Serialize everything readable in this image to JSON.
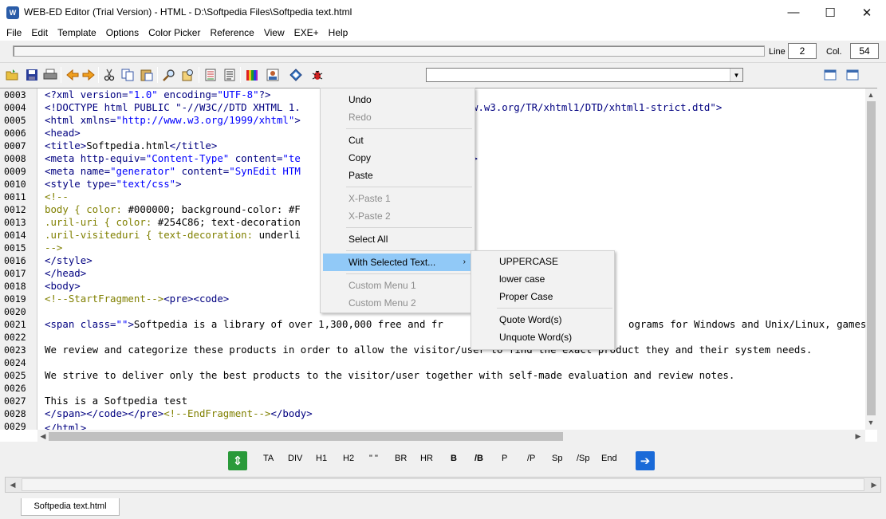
{
  "window": {
    "title": "WEB-ED Editor (Trial Version) - HTML - D:\\Softpedia Files\\Softpedia text.html",
    "minimize": "—",
    "maximize": "☐",
    "close": "✕"
  },
  "menubar": [
    "File",
    "Edit",
    "Template",
    "Options",
    "Color Picker",
    "Reference",
    "View",
    "EXE+",
    "Help"
  ],
  "position": {
    "line_label": "Line",
    "line_value": "2",
    "col_label": "Col.",
    "col_value": "54"
  },
  "line_numbers": [
    "0003",
    "0004",
    "0005",
    "0006",
    "0007",
    "0008",
    "0009",
    "0010",
    "0011",
    "0012",
    "0013",
    "0014",
    "0015",
    "0016",
    "0017",
    "0018",
    "0019",
    "0020",
    "0021",
    "0022",
    "0023",
    "0024",
    "0025",
    "0026",
    "0027",
    "0028",
    "0029"
  ],
  "code": {
    "l0003a": "<?xml version=",
    "l0003b": "\"1.0\"",
    "l0003c": " encoding=",
    "l0003d": "\"UTF-8\"",
    "l0003e": "?>",
    "l0004a": "<!DOCTYPE html PUBLIC \"-//W3C//DTD XHTML 1.",
    "l0004b": "w.w3.org/TR/xhtml1/DTD/xhtml1-strict.dtd\">",
    "l0005a": "<html xmlns=",
    "l0005b": "\"http://www.w3.org/1999/xhtml\"",
    "l0005c": ">",
    "l0006": "<head>",
    "l0007a": "<title>",
    "l0007b": "Softpedia.html",
    "l0007c": "</title>",
    "l0008a": "<meta http-equiv=",
    "l0008b": "\"Content-Type\"",
    "l0008c": " content=",
    "l0008d": "\"te",
    "l0008e": "/>",
    "l0009a": "<meta name=",
    "l0009b": "\"generator\"",
    "l0009c": " content=",
    "l0009d": "\"SynEdit HTM",
    "l0010a": "<style type=",
    "l0010b": "\"text/css\"",
    "l0010c": ">",
    "l0011": "<!--",
    "l0012a": "body { color: ",
    "l0012b": "#000000; background-color: #F",
    "l0013a": ".uril-uri { color: ",
    "l0013b": "#254C86; text-decoration",
    "l0014a": ".uril-visiteduri { text-decoration: ",
    "l0014b": "underli",
    "l0015": "-->",
    "l0016": "</style>",
    "l0017": "</head>",
    "l0018": "<body>",
    "l0019a": "<!--StartFragment-->",
    "l0019b": "<pre><code>",
    "l0021a": "<span class=",
    "l0021b": "\"\"",
    "l0021c": ">",
    "l0021d": "Softpedia is a library of over 1,300,000 free and fr",
    "l0021e": "ograms for Windows and Unix/Linux, games,",
    "l0023": "We review and categorize these products in order to allow the visitor/user to find the exact product they and their system needs.",
    "l0025": "We strive to deliver only the best products to the visitor/user together with self-made evaluation and review notes.",
    "l0027": "This is a Softpedia test",
    "l0028a": "</span></code></pre>",
    "l0028b": "<!--EndFragment-->",
    "l0028c": "</body>",
    "l0029": "</html>"
  },
  "context_menu": {
    "undo": "Undo",
    "redo": "Redo",
    "cut": "Cut",
    "copy": "Copy",
    "paste": "Paste",
    "xpaste1": "X-Paste 1",
    "xpaste2": "X-Paste 2",
    "select_all": "Select All",
    "with_selected": "With Selected Text...",
    "custom1": "Custom Menu 1",
    "custom2": "Custom Menu 2"
  },
  "submenu": {
    "uppercase": "UPPERCASE",
    "lowercase": "lower case",
    "propercase": "Proper Case",
    "quote": "Quote Word(s)",
    "unquote": "Unquote Word(s)"
  },
  "tagbar": [
    "TA",
    "DIV",
    "H1",
    "H2",
    "\" \"",
    "BR",
    "HR",
    "B",
    "/B",
    "P",
    "/P",
    "Sp",
    "/Sp",
    "End"
  ],
  "file_tab": "Softpedia text.html",
  "colors": {
    "accent_highlight": "#91c9f7",
    "tag": "#000080",
    "value": "#0000ff",
    "comment": "#808000"
  }
}
